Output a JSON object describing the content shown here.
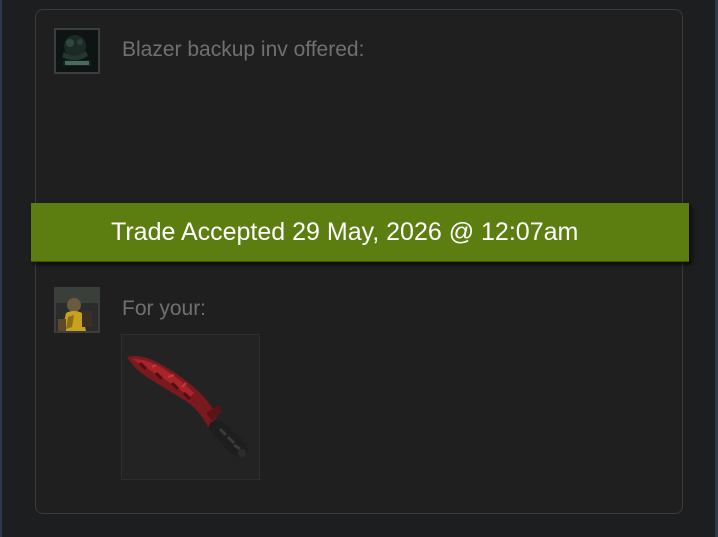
{
  "trade": {
    "them_label": "Blazer backup inv offered:",
    "you_label": "For your:",
    "status_banner": "Trade Accepted 29 May, 2026 @ 12:07am",
    "status_color": "#5c7e10",
    "them_items": [],
    "you_items": [
      {
        "icon": "kukri-knife-crimson-icon"
      }
    ]
  }
}
